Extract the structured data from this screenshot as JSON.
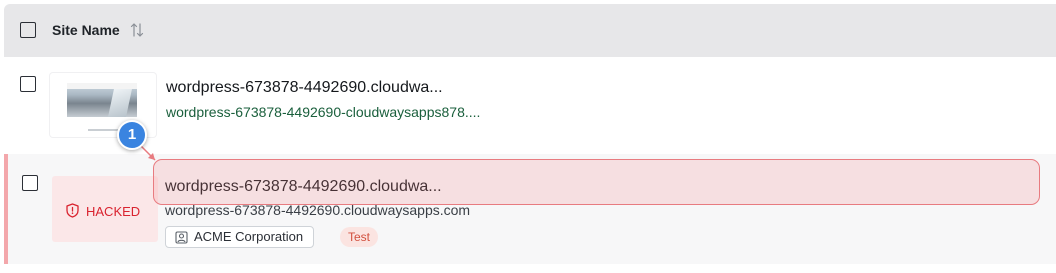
{
  "table": {
    "header": {
      "column_title": "Site Name",
      "sort_icon": "sort-arrows-icon"
    },
    "rows": [
      {
        "title": "wordpress-673878-4492690.cloudwa...",
        "url": "wordpress-673878-4492690-cloudwaysapps878....",
        "thumbnail": "site-preview-thumbnail"
      },
      {
        "title": "wordpress-673878-4492690.cloudwa...",
        "url": "wordpress-673878-4492690.cloudwaysapps.com",
        "status": "HACKED",
        "status_icon": "shield-alert-icon",
        "organization": "ACME Corporation",
        "organization_icon": "user-badge-icon",
        "environment": "Test"
      }
    ]
  },
  "annotation": {
    "marker_number": "1",
    "color": "#3a84e0",
    "highlight_color": "#e87b80"
  }
}
